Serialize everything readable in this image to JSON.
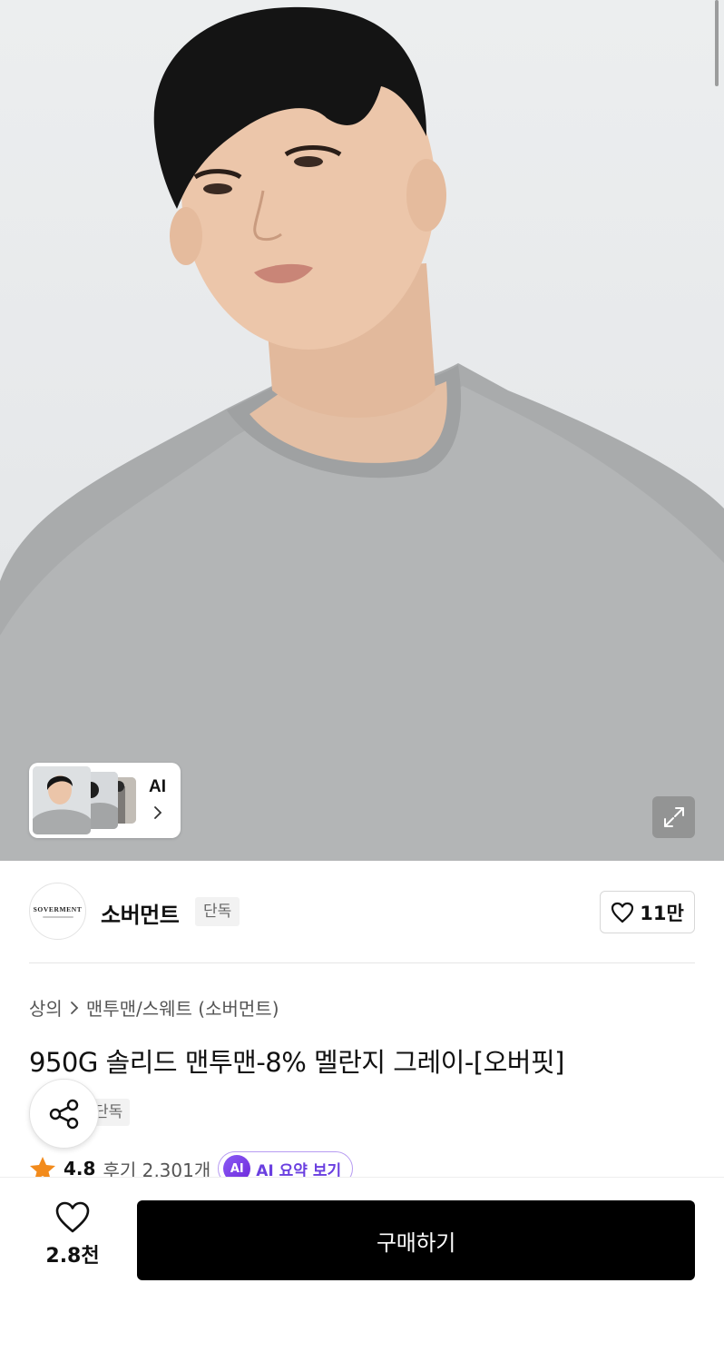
{
  "hero": {
    "thumbs_label": "AI",
    "expand_icon": "expand-icon"
  },
  "brand": {
    "logo_text": "SOVERMENT",
    "name": "소버먼트",
    "badge": "단독",
    "like_count": "11만"
  },
  "product": {
    "breadcrumb": [
      "상의",
      "맨투맨/스웨트 (소버먼트)"
    ],
    "title": "950G 솔리드 맨투맨-8% 멜란지 그레이-[오버핏]",
    "badge": "단독",
    "rating": "4.8",
    "review_label": "후기 2,301개",
    "ai_badge": "AI",
    "ai_summary_label": "AI 요약 보기"
  },
  "bottom_bar": {
    "like_count": "2.8천",
    "buy_label": "구매하기"
  },
  "colors": {
    "accent_purple": "#6a3fe0",
    "star": "#f28b1c",
    "buy_button": "#000000"
  }
}
